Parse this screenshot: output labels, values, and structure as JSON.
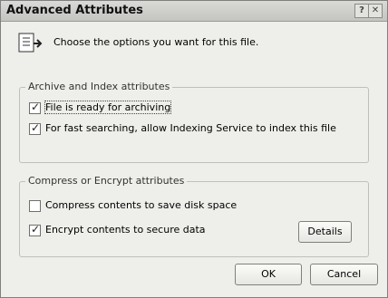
{
  "dialog": {
    "title": "Advanced Attributes",
    "help_label": "?",
    "close_label": "✕",
    "intro_text": "Choose the options you want for this file."
  },
  "archive_group": {
    "legend": "Archive and Index attributes",
    "items": [
      {
        "label": "File is ready for archiving",
        "checked": true
      },
      {
        "label": "For fast searching, allow Indexing Service to index this file",
        "checked": true
      }
    ]
  },
  "compress_group": {
    "legend": "Compress or Encrypt attributes",
    "items": [
      {
        "label": "Compress contents to save disk space",
        "checked": false
      },
      {
        "label": "Encrypt contents to secure data",
        "checked": true
      }
    ],
    "details_label": "Details"
  },
  "buttons": {
    "ok_label": "OK",
    "cancel_label": "Cancel"
  },
  "icons": {
    "file": "file-options-icon"
  }
}
